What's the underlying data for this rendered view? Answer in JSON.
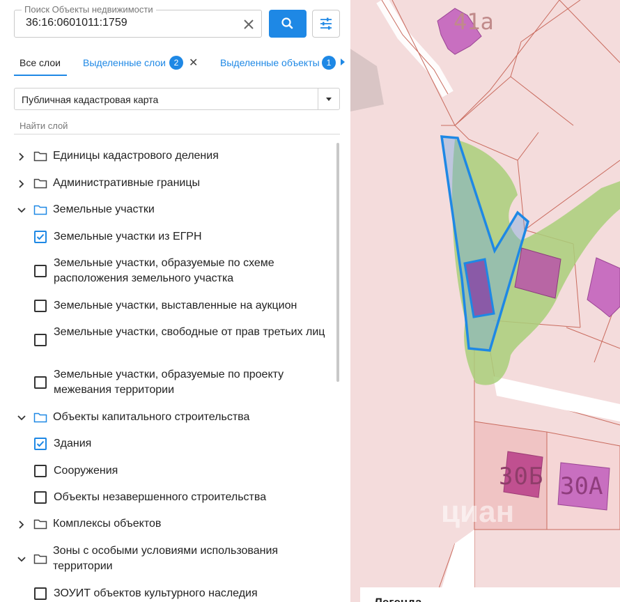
{
  "search": {
    "label": "Поиск Объекты недвижимости",
    "value": "36:16:0601011:1759"
  },
  "tabs": {
    "all": "Все слои",
    "selected_layers": "Выделенные слои",
    "selected_layers_count": "2",
    "selected_objects": "Выделенные объекты",
    "selected_objects_count": "1"
  },
  "map_select": {
    "value": "Публичная кадастровая карта"
  },
  "find_layer": {
    "placeholder": "Найти слой"
  },
  "tree": {
    "g1": "Единицы кадастрового деления",
    "g2": "Административные границы",
    "g3": "Земельные участки",
    "g3_items": [
      {
        "label": "Земельные участки из ЕГРН",
        "checked": true
      },
      {
        "label": "Земельные участки, образуемые по схеме расположения земельного участка",
        "checked": false
      },
      {
        "label": "Земельные участки, выставленные на аукцион",
        "checked": false
      },
      {
        "label": "Земельные участки, свободные от прав третьих лиц",
        "checked": false
      },
      {
        "label": "Земельные участки, образуемые по проекту межевания территории",
        "checked": false
      }
    ],
    "g4": "Объекты капитального строительства",
    "g4_items": [
      {
        "label": "Здания",
        "checked": true
      },
      {
        "label": "Сооружения",
        "checked": false
      },
      {
        "label": "Объекты незавершенного строительства",
        "checked": false
      }
    ],
    "g5": "Комплексы объектов",
    "g6": "Зоны с особыми условиями использования территории",
    "g6_items": [
      {
        "label": "ЗОУИТ объектов культурного наследия",
        "checked": false
      }
    ]
  },
  "map": {
    "labels": [
      "41а",
      "30Б",
      "30А"
    ],
    "watermark": "циан",
    "legend_title": "Легенда"
  },
  "colors": {
    "accent": "#1e88e5",
    "map_bg": "#f4dcdc",
    "building": "#c86fc0",
    "vegetation": "#a9cf7a",
    "parcel_highlight": "#1e88e5"
  }
}
